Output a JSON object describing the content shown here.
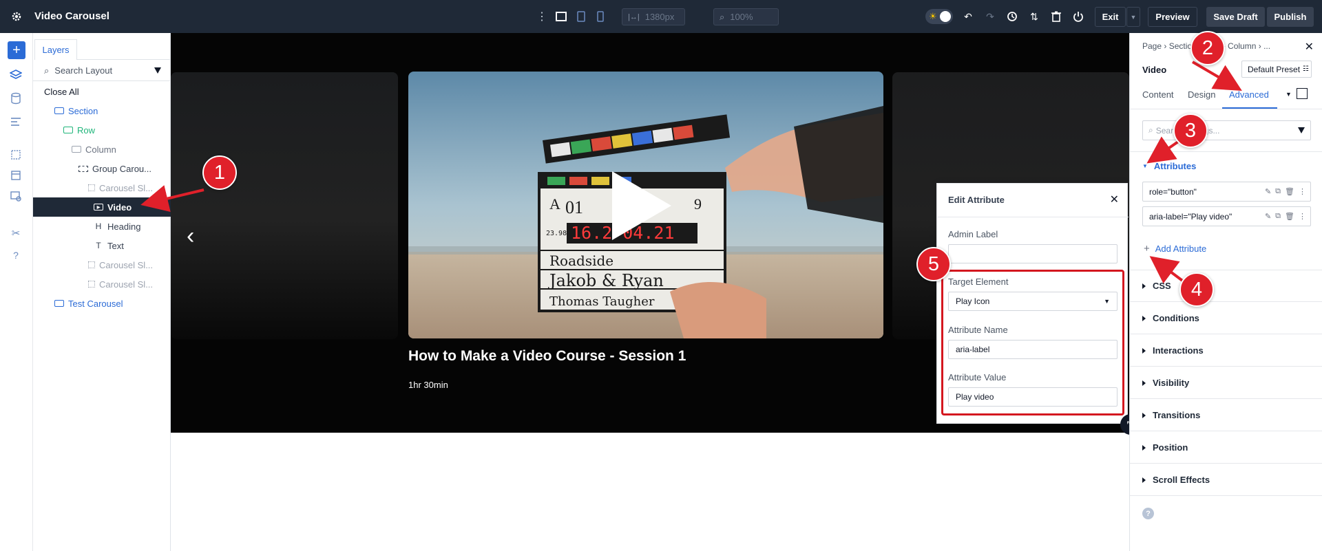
{
  "topbar": {
    "title": "Video Carousel",
    "width_value": "1380px",
    "zoom_value": "100%",
    "exit_label": "Exit",
    "preview_label": "Preview",
    "save_draft_label": "Save Draft",
    "publish_label": "Publish"
  },
  "layers": {
    "tab_label": "Layers",
    "search_placeholder": "Search Layout",
    "close_all_label": "Close All",
    "items": [
      {
        "label": "Section",
        "icon": "section-icon",
        "color": "#2b6bd6"
      },
      {
        "label": "Row",
        "icon": "row-icon",
        "color": "#1fb57a"
      },
      {
        "label": "Column",
        "icon": "column-icon",
        "color": "#6b7280"
      },
      {
        "label": "Group Carou...",
        "icon": "carousel-icon",
        "color": "#374151"
      },
      {
        "label": "Carousel Sl...",
        "icon": "slide-icon",
        "color": "#9ca3af"
      },
      {
        "label": "Video",
        "icon": "video-icon",
        "color": "#ffffff"
      },
      {
        "label": "Heading",
        "icon": "heading-icon",
        "color": "#374151"
      },
      {
        "label": "Text",
        "icon": "text-icon",
        "color": "#374151"
      },
      {
        "label": "Carousel Sl...",
        "icon": "slide-icon",
        "color": "#9ca3af"
      },
      {
        "label": "Carousel Sl...",
        "icon": "slide-icon",
        "color": "#9ca3af"
      },
      {
        "label": "Test Carousel",
        "icon": "section-icon",
        "color": "#2b6bd6"
      }
    ]
  },
  "canvas": {
    "slide_title": "How to Make a Video Course - Session 1",
    "slide_duration": "1hr 30min",
    "clapper": {
      "letter": "A",
      "number_a": "01",
      "number_b": "9",
      "timecode": "16.2  04.21",
      "fps": "23.98",
      "line1": "Roadside",
      "line2": "Jakob & Ryan",
      "line3": "Thomas Taugher"
    }
  },
  "edit_attribute": {
    "title": "Edit Attribute",
    "admin_label": "Admin Label",
    "admin_value": "",
    "target_label": "Target Element",
    "target_value": "Play Icon",
    "name_label": "Attribute Name",
    "name_value": "aria-label",
    "value_label": "Attribute Value",
    "value_value": "Play video"
  },
  "right_panel": {
    "breadcrumb": "Page › Section › Row › Column › ...",
    "module_name": "Video",
    "preset_label": "Default Preset",
    "tabs": [
      "Content",
      "Design",
      "Advanced"
    ],
    "search_placeholder": "Search settings...",
    "attributes_label": "Attributes",
    "attributes": [
      "role=\"button\"",
      "aria-label=\"Play video\""
    ],
    "add_attribute_label": "Add Attribute",
    "sections": [
      "CSS",
      "Conditions",
      "Interactions",
      "Visibility",
      "Transitions",
      "Position",
      "Scroll Effects"
    ]
  },
  "callouts": [
    "1",
    "2",
    "3",
    "4",
    "5"
  ],
  "colors": {
    "accent": "#2b6bd6",
    "callout_red": "#e0202a",
    "topbar": "#1f2937"
  }
}
